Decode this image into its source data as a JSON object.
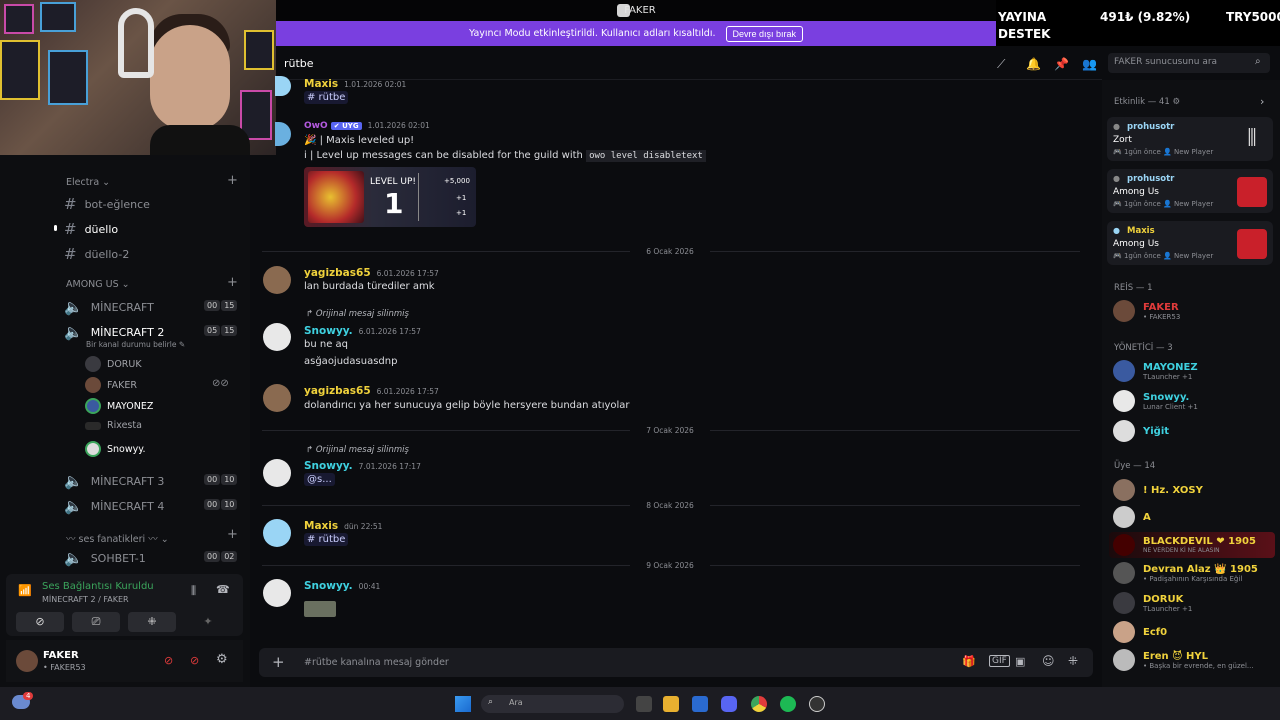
{
  "window": {
    "title": "FAKER"
  },
  "banner": {
    "text": "Yayıncı Modu etkinleştirildi. Kullanıcı adları kısaltıldı.",
    "button": "Devre dışı bırak"
  },
  "overlay": {
    "line1": "YAYINA",
    "line2": "DESTEK",
    "amount": "491₺ (9.82%)",
    "target": "TRY5000"
  },
  "sidebar": {
    "categories": [
      {
        "label": "Electra ⌄"
      },
      {
        "label": "AMONG US ⌄"
      },
      {
        "label": "〰 ses fanatikleri 〰 ⌄"
      }
    ],
    "text_channels": [
      "bot-eğlence",
      "düello",
      "düello-2"
    ],
    "voice_channels": [
      {
        "name": "MİNECRAFT",
        "a": "00",
        "b": "15"
      },
      {
        "name": "MİNECRAFT 2",
        "a": "05",
        "b": "15",
        "status": "Bir kanal durumu belirle ✎"
      },
      {
        "name": "MİNECRAFT 3",
        "a": "00",
        "b": "10"
      },
      {
        "name": "MİNECRAFT 4",
        "a": "00",
        "b": "10"
      },
      {
        "name": "SOHBET-1",
        "a": "00",
        "b": "02"
      }
    ],
    "voice_members": [
      "DORUK",
      "FAKER",
      "MAYONEZ",
      "Rixesta",
      "Snowyy."
    ]
  },
  "voice_panel": {
    "status": "Ses Bağlantısı Kuruldu",
    "sub": "MİNECRAFT 2 / FAKER"
  },
  "user": {
    "name": "FAKER",
    "tag": "• FAKER53"
  },
  "header": {
    "channel": "rütbe",
    "search_placeholder": "FAKER sunucusunu ara"
  },
  "messages": [
    {
      "author": "Maxis",
      "time": "1.01.2026 02:01",
      "text": "# rütbe"
    },
    {
      "author": "OwO",
      "badge": "✔ UYG",
      "time": "1.01.2026 02:01",
      "line1": "🎉 | Maxis leveled up!",
      "line2": "i | Level up messages can be disabled for the guild with",
      "code": "owo level disabletext"
    },
    {
      "author": "yagizbas65",
      "time": "6.01.2026 17:57",
      "text": "lan burdada türediler amk"
    },
    {
      "reply": "Orijinal mesaj silinmiş",
      "author": "Snowyy.",
      "time": "6.01.2026 17:57",
      "line1": "bu ne aq",
      "line2": "asğaojudasuasdnp"
    },
    {
      "author": "yagizbas65",
      "time": "6.01.2026 17:57",
      "text": "dolandırıcı ya her sunucuya gelip böyle hersyere bundan atıyolar"
    },
    {
      "reply": "Orijinal mesaj silinmiş",
      "author": "Snowyy.",
      "time": "7.01.2026 17:17",
      "text": "@s..."
    },
    {
      "author": "Maxis",
      "time": "dün 22:51",
      "text": "# rütbe"
    },
    {
      "author": "Snowyy.",
      "time": "00:41"
    }
  ],
  "levelcard": {
    "title": "LEVEL UP!",
    "level": "1",
    "r1": "+5,000",
    "r2": "+1",
    "r3": "+1"
  },
  "dates": [
    "6 Ocak 2026",
    "7 Ocak 2026",
    "8 Ocak 2026",
    "9 Ocak 2026"
  ],
  "composer": {
    "placeholder": "#rütbe kanalına mesaj gönder"
  },
  "members": {
    "activity_header": "Etkinlik — 41 ⚙",
    "activities": [
      {
        "name": "prohusotr",
        "game": "Zort",
        "meta": "🎮 1gün önce  👤 New Player"
      },
      {
        "name": "prohusotr",
        "game": "Among Us",
        "meta": "🎮 1gün önce  👤 New Player"
      },
      {
        "name": "Maxis",
        "game": "Among Us",
        "meta": "🎮 1gün önce  👤 New Player"
      }
    ],
    "groups": [
      {
        "label": "REİS — 1",
        "items": [
          {
            "name": "FAKER",
            "sub": "• FAKER53",
            "color": "#e03b3b"
          }
        ]
      },
      {
        "label": "YÖNETİCİ — 3",
        "items": [
          {
            "name": "MAYONEZ",
            "sub": "TLauncher +1",
            "color": "#3fd1e0"
          },
          {
            "name": "Snowyy.",
            "sub": "Lunar Client +1",
            "color": "#3fd1e0"
          },
          {
            "name": "Yiğit",
            "sub": "",
            "color": "#3fd1e0"
          }
        ]
      },
      {
        "label": "Üye — 14",
        "items": [
          {
            "name": "! Hz. XOSY",
            "sub": "",
            "color": "#f0d23c"
          },
          {
            "name": "A",
            "sub": "",
            "color": "#f0d23c"
          },
          {
            "name": "BLACKDEVIL ❤ 1905",
            "sub": "NE VERDEN Kİ NE ALASIN",
            "color": "#f0d23c"
          },
          {
            "name": "Devran Alaz 👑 1905",
            "sub": "• Padişahının Karşısında Eğil",
            "color": "#f0d23c"
          },
          {
            "name": "DORUK",
            "sub": "TLauncher +1",
            "color": "#f0d23c"
          },
          {
            "name": "Ecf0",
            "sub": "",
            "color": "#f0d23c"
          },
          {
            "name": "Eren 😈 HYL",
            "sub": "• Başka bir evrende, en güzel...",
            "color": "#f0d23c"
          }
        ]
      }
    ]
  },
  "taskbar": {
    "search": "Ara",
    "badge": "4"
  }
}
